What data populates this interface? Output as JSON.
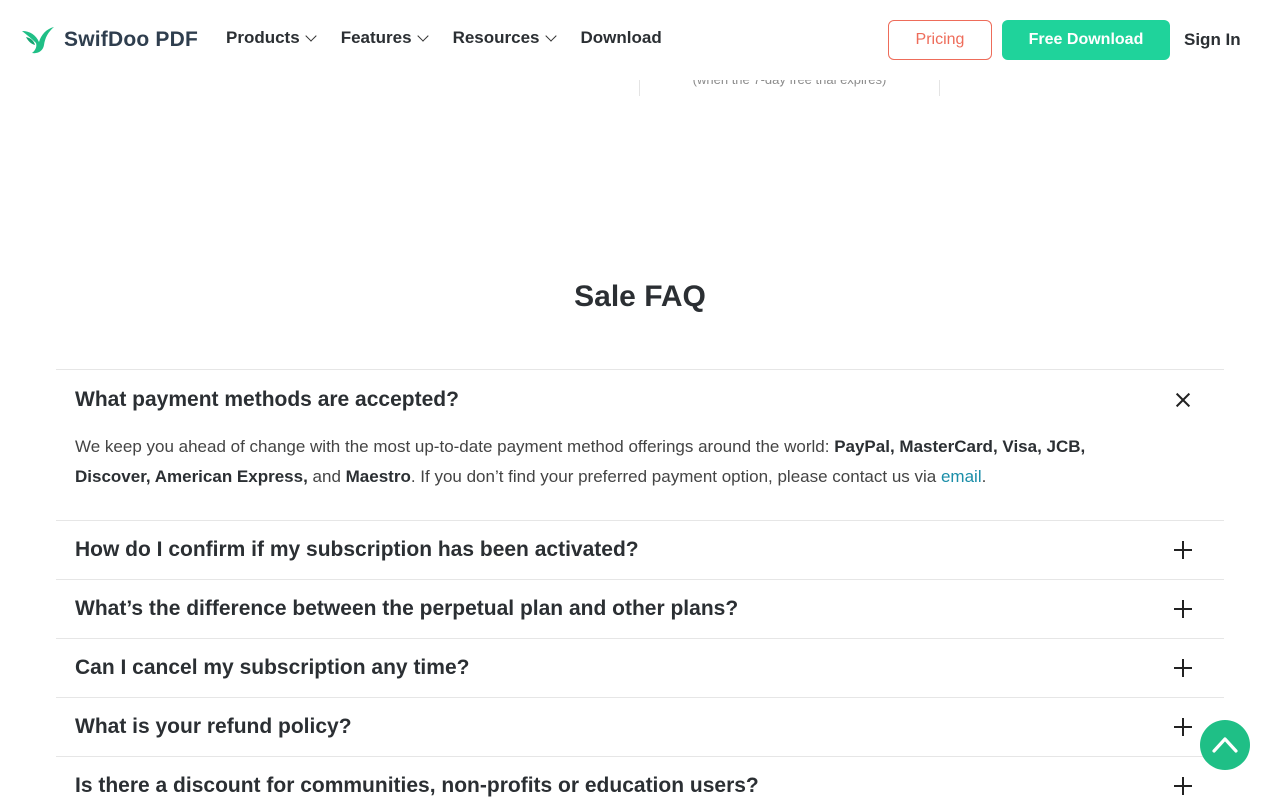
{
  "brand": {
    "name": "SwifDoo PDF",
    "accent": "#1fd39b",
    "pricing_color": "#ee6c5a",
    "link_color": "#1a8ea8"
  },
  "nav": {
    "items": [
      {
        "label": "Products",
        "has_dropdown": true
      },
      {
        "label": "Features",
        "has_dropdown": true
      },
      {
        "label": "Resources",
        "has_dropdown": true
      },
      {
        "label": "Download",
        "has_dropdown": false
      }
    ],
    "pricing_label": "Pricing",
    "download_label": "Free Download",
    "signin_label": "Sign In"
  },
  "plan_remnant": {
    "note": "(when the 7-day free trial expires)"
  },
  "faq": {
    "title": "Sale FAQ",
    "open_answer": {
      "intro": "We keep you ahead of change with the most up-to-date payment method offerings around the world: ",
      "methods": [
        "PayPal",
        "MasterCard",
        "Visa",
        "JCB",
        "Discover",
        "American Express"
      ],
      "and": " and ",
      "last_method": "Maestro",
      "outro": ". If you don’t find your preferred payment option, please contact us via ",
      "link_text": "email",
      "end": "."
    },
    "items": [
      {
        "question": "What payment methods are accepted?",
        "expanded": true
      },
      {
        "question": "How do I confirm if my subscription has been activated?",
        "expanded": false
      },
      {
        "question": "What’s the difference between the perpetual plan and other plans?",
        "expanded": false
      },
      {
        "question": "Can I cancel my subscription any time?",
        "expanded": false
      },
      {
        "question": "What is your refund policy?",
        "expanded": false
      },
      {
        "question": "Is there a discount for communities, non-profits or education users?",
        "expanded": false
      }
    ]
  },
  "icons": {
    "close": "close-icon",
    "expand": "plus-icon",
    "back_to_top": "chevron-up-icon"
  }
}
